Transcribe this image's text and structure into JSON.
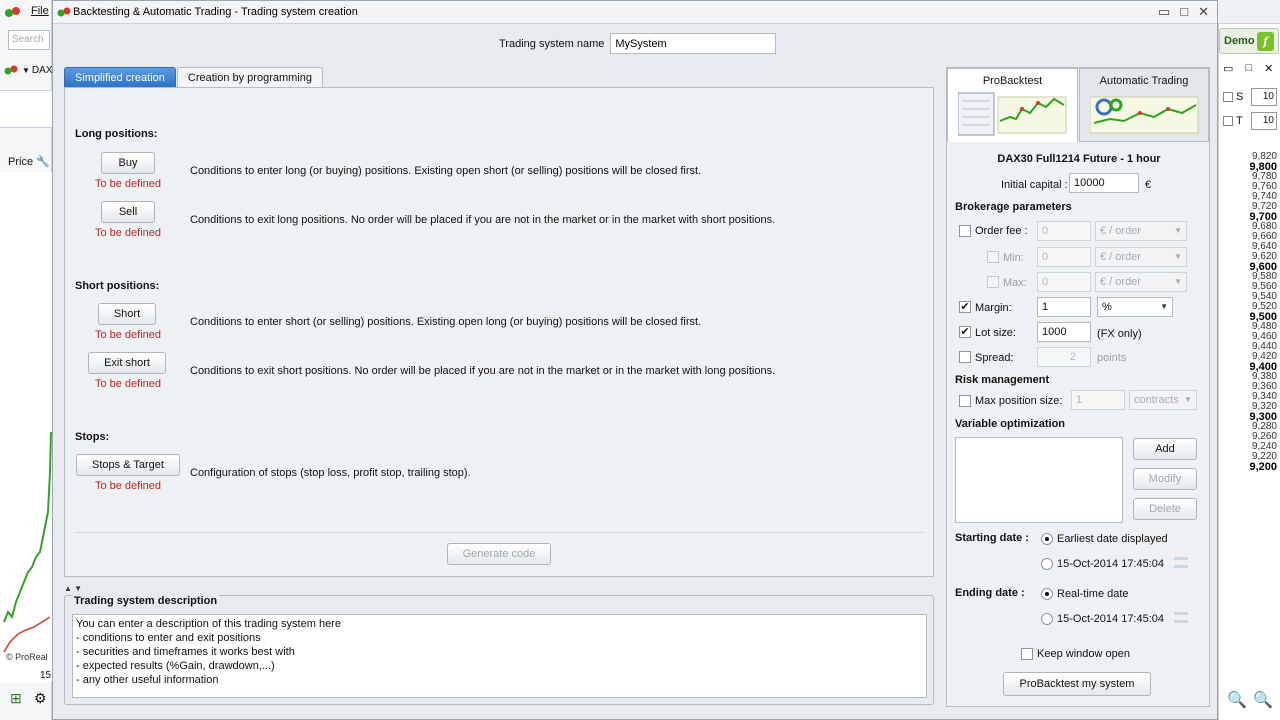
{
  "window": {
    "title": "Backtesting & Automatic Trading - Trading system creation"
  },
  "background": {
    "menu_file": "File",
    "search_placeholder": "Search",
    "instrument": "DAX",
    "price_label": "Price",
    "watermark": "© ProReal",
    "demo_label": "Demo",
    "mini_fields": [
      {
        "label": "S",
        "value": "10"
      },
      {
        "label": "T",
        "value": "10"
      }
    ],
    "bottom_number": "15",
    "prices": [
      {
        "v": "9,820",
        "b": false
      },
      {
        "v": "9,800",
        "b": true
      },
      {
        "v": "9,780",
        "b": false
      },
      {
        "v": "9,760",
        "b": false
      },
      {
        "v": "9,740",
        "b": false
      },
      {
        "v": "9,720",
        "b": false
      },
      {
        "v": "9,700",
        "b": true
      },
      {
        "v": "9,680",
        "b": false
      },
      {
        "v": "9,660",
        "b": false
      },
      {
        "v": "9,640",
        "b": false
      },
      {
        "v": "9,620",
        "b": false
      },
      {
        "v": "9,600",
        "b": true
      },
      {
        "v": "9,580",
        "b": false
      },
      {
        "v": "9,560",
        "b": false
      },
      {
        "v": "9,540",
        "b": false
      },
      {
        "v": "9,520",
        "b": false
      },
      {
        "v": "9,500",
        "b": true
      },
      {
        "v": "9,480",
        "b": false
      },
      {
        "v": "9,460",
        "b": false
      },
      {
        "v": "9,440",
        "b": false
      },
      {
        "v": "9,420",
        "b": false
      },
      {
        "v": "9,400",
        "b": true
      },
      {
        "v": "9,380",
        "b": false
      },
      {
        "v": "9,360",
        "b": false
      },
      {
        "v": "9,340",
        "b": false
      },
      {
        "v": "9,320",
        "b": false
      },
      {
        "v": "9,300",
        "b": true
      },
      {
        "v": "9,280",
        "b": false
      },
      {
        "v": "9,260",
        "b": false
      },
      {
        "v": "9,240",
        "b": false
      },
      {
        "v": "9,220",
        "b": false
      },
      {
        "v": "9,200",
        "b": true
      }
    ]
  },
  "header": {
    "name_label": "Trading system name",
    "name_value": "MySystem"
  },
  "tabs": {
    "simplified": "Simplified creation",
    "programming": "Creation by programming"
  },
  "long": {
    "heading": "Long positions:",
    "buy_label": "Buy",
    "buy_status": "To be defined",
    "buy_desc": "Conditions to enter long (or buying) positions. Existing open short (or selling) positions will be closed first.",
    "sell_label": "Sell",
    "sell_status": "To be defined",
    "sell_desc": "Conditions to exit long positions. No order will be placed if you are not in the market or in the market with short positions."
  },
  "short": {
    "heading": "Short positions:",
    "short_label": "Short",
    "short_status": "To be defined",
    "short_desc": "Conditions to enter short (or selling) positions. Existing open long (or buying) positions will be closed first.",
    "exit_label": "Exit short",
    "exit_status": "To be defined",
    "exit_desc": "Conditions to exit short positions. No order will be placed if you are not in the market or in the market with long positions."
  },
  "stops": {
    "heading": "Stops:",
    "label": "Stops & Target",
    "status": "To be defined",
    "desc": "Configuration of stops (stop loss, profit stop, trailing stop)."
  },
  "generate_label": "Generate code",
  "description": {
    "title": "Trading system description",
    "lines": [
      "You can enter a description of this trading system here",
      "- conditions to enter and exit positions",
      "- securities and timeframes it works best with",
      "- expected results (%Gain, drawdown,...)",
      "- any other useful information"
    ]
  },
  "right": {
    "tab_probacktest": "ProBacktest",
    "tab_auto": "Automatic Trading",
    "instrument": "DAX30  Full1214 Future - 1 hour",
    "capital_label": "Initial capital :",
    "capital_value": "10000",
    "currency": "€",
    "brokerage_heading": "Brokerage parameters",
    "order_fee_label": "Order fee :",
    "order_fee_value": "0",
    "order_fee_unit": "€ / order",
    "min_label": "Min:",
    "min_value": "0",
    "min_unit": "€ / order",
    "max_label": "Max:",
    "max_value": "0",
    "max_unit": "€ / order",
    "margin_label": "Margin:",
    "margin_value": "1",
    "margin_unit": "%",
    "lot_label": "Lot size:",
    "lot_value": "1000",
    "lot_note": "(FX only)",
    "spread_label": "Spread:",
    "spread_value": "2",
    "spread_unit": "points",
    "risk_heading": "Risk management",
    "maxpos_label": "Max position size:",
    "maxpos_value": "1",
    "maxpos_unit": "contracts",
    "varopt_heading": "Variable optimization",
    "add_label": "Add",
    "modify_label": "Modify",
    "delete_label": "Delete",
    "start_label": "Starting date :",
    "start_opt1": "Earliest date displayed",
    "start_opt2": "15-Oct-2014 17:45:04",
    "end_label": "Ending date :",
    "end_opt1": "Real-time date",
    "end_opt2": "15-Oct-2014 17:45:04",
    "keep_open_label": "Keep window open",
    "run_label": "ProBacktest my system"
  },
  "colors": {
    "accent_tab": "#2e73c7",
    "undefined_text": "#c0281d",
    "chart_green": "#2fa51e"
  }
}
